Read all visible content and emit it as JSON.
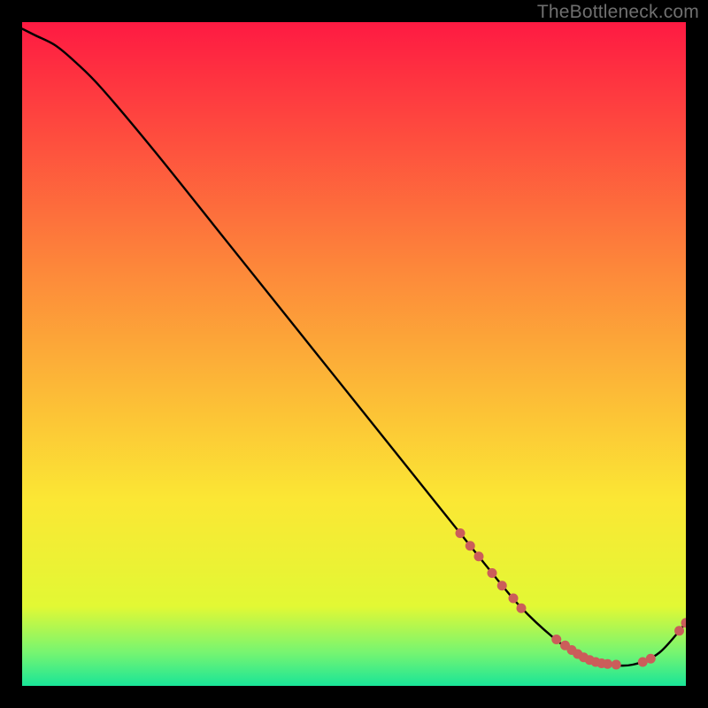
{
  "watermark": "TheBottleneck.com",
  "colors": {
    "gradient_top": "#fe1a42",
    "gradient_mid1": "#fd8a3a",
    "gradient_mid2": "#fbe734",
    "gradient_low": "#e2f834",
    "gradient_green1": "#76f571",
    "gradient_green2": "#19e598",
    "curve": "#000000",
    "marker": "#cb5d5a",
    "background": "#000000"
  },
  "chart_data": {
    "type": "line",
    "title": "",
    "xlabel": "",
    "ylabel": "",
    "xlim": [
      0,
      100
    ],
    "ylim": [
      0,
      100
    ],
    "grid": false,
    "legend": false,
    "curve": [
      {
        "x": 0,
        "y": 99
      },
      {
        "x": 2,
        "y": 98
      },
      {
        "x": 5,
        "y": 96.5
      },
      {
        "x": 8,
        "y": 94
      },
      {
        "x": 12,
        "y": 90
      },
      {
        "x": 20,
        "y": 80.5
      },
      {
        "x": 30,
        "y": 68
      },
      {
        "x": 40,
        "y": 55.5
      },
      {
        "x": 50,
        "y": 43
      },
      {
        "x": 58,
        "y": 33
      },
      {
        "x": 64,
        "y": 25.5
      },
      {
        "x": 70,
        "y": 18
      },
      {
        "x": 75,
        "y": 12
      },
      {
        "x": 80,
        "y": 7.3
      },
      {
        "x": 84,
        "y": 4.5
      },
      {
        "x": 88,
        "y": 3.3
      },
      {
        "x": 92,
        "y": 3.2
      },
      {
        "x": 96,
        "y": 5.0
      },
      {
        "x": 100,
        "y": 9.5
      }
    ],
    "markers": [
      {
        "x": 66,
        "y": 23.0
      },
      {
        "x": 67.5,
        "y": 21.1
      },
      {
        "x": 68.8,
        "y": 19.5
      },
      {
        "x": 70.8,
        "y": 17.0
      },
      {
        "x": 72.3,
        "y": 15.1
      },
      {
        "x": 74.0,
        "y": 13.2
      },
      {
        "x": 75.2,
        "y": 11.7
      },
      {
        "x": 80.5,
        "y": 7.0
      },
      {
        "x": 81.8,
        "y": 6.1
      },
      {
        "x": 82.8,
        "y": 5.4
      },
      {
        "x": 83.7,
        "y": 4.8
      },
      {
        "x": 84.6,
        "y": 4.3
      },
      {
        "x": 85.5,
        "y": 3.9
      },
      {
        "x": 86.4,
        "y": 3.6
      },
      {
        "x": 87.3,
        "y": 3.4
      },
      {
        "x": 88.2,
        "y": 3.3
      },
      {
        "x": 89.5,
        "y": 3.2
      },
      {
        "x": 93.5,
        "y": 3.6
      },
      {
        "x": 94.7,
        "y": 4.1
      },
      {
        "x": 99.0,
        "y": 8.3
      },
      {
        "x": 100.0,
        "y": 9.5
      }
    ]
  }
}
